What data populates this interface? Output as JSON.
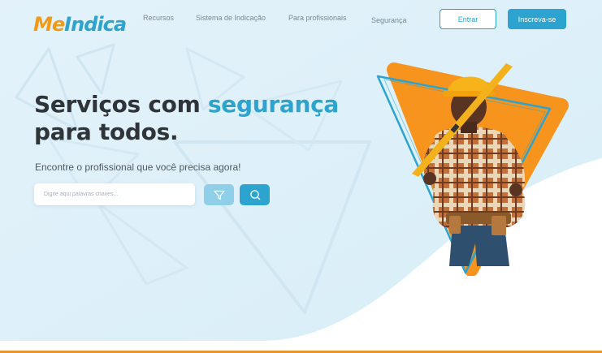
{
  "header": {
    "logo_part1": "Me",
    "logo_part2": "Indica",
    "nav": [
      {
        "label": "Recursos"
      },
      {
        "label": "Sistema de Indicação"
      },
      {
        "label": "Para profissionais"
      },
      {
        "label": "Segurança"
      }
    ],
    "login_label": "Entrar",
    "signup_label": "Inscreva-se"
  },
  "hero": {
    "title_part1": "Serviços com ",
    "title_accent": "segurança",
    "title_part2": "para todos.",
    "subtitle": "Encontre o profissional que você precisa agora!",
    "search_placeholder": "Digite aqui palavras chaves..."
  },
  "icons": {
    "filter": "filter-icon",
    "search": "search-icon",
    "illustration": "worker-illustration"
  },
  "colors": {
    "brand_blue": "#2da3cf",
    "brand_orange": "#f39a14",
    "title_dark": "#2e3438",
    "bg_light_blue": "#e4f3fa"
  }
}
